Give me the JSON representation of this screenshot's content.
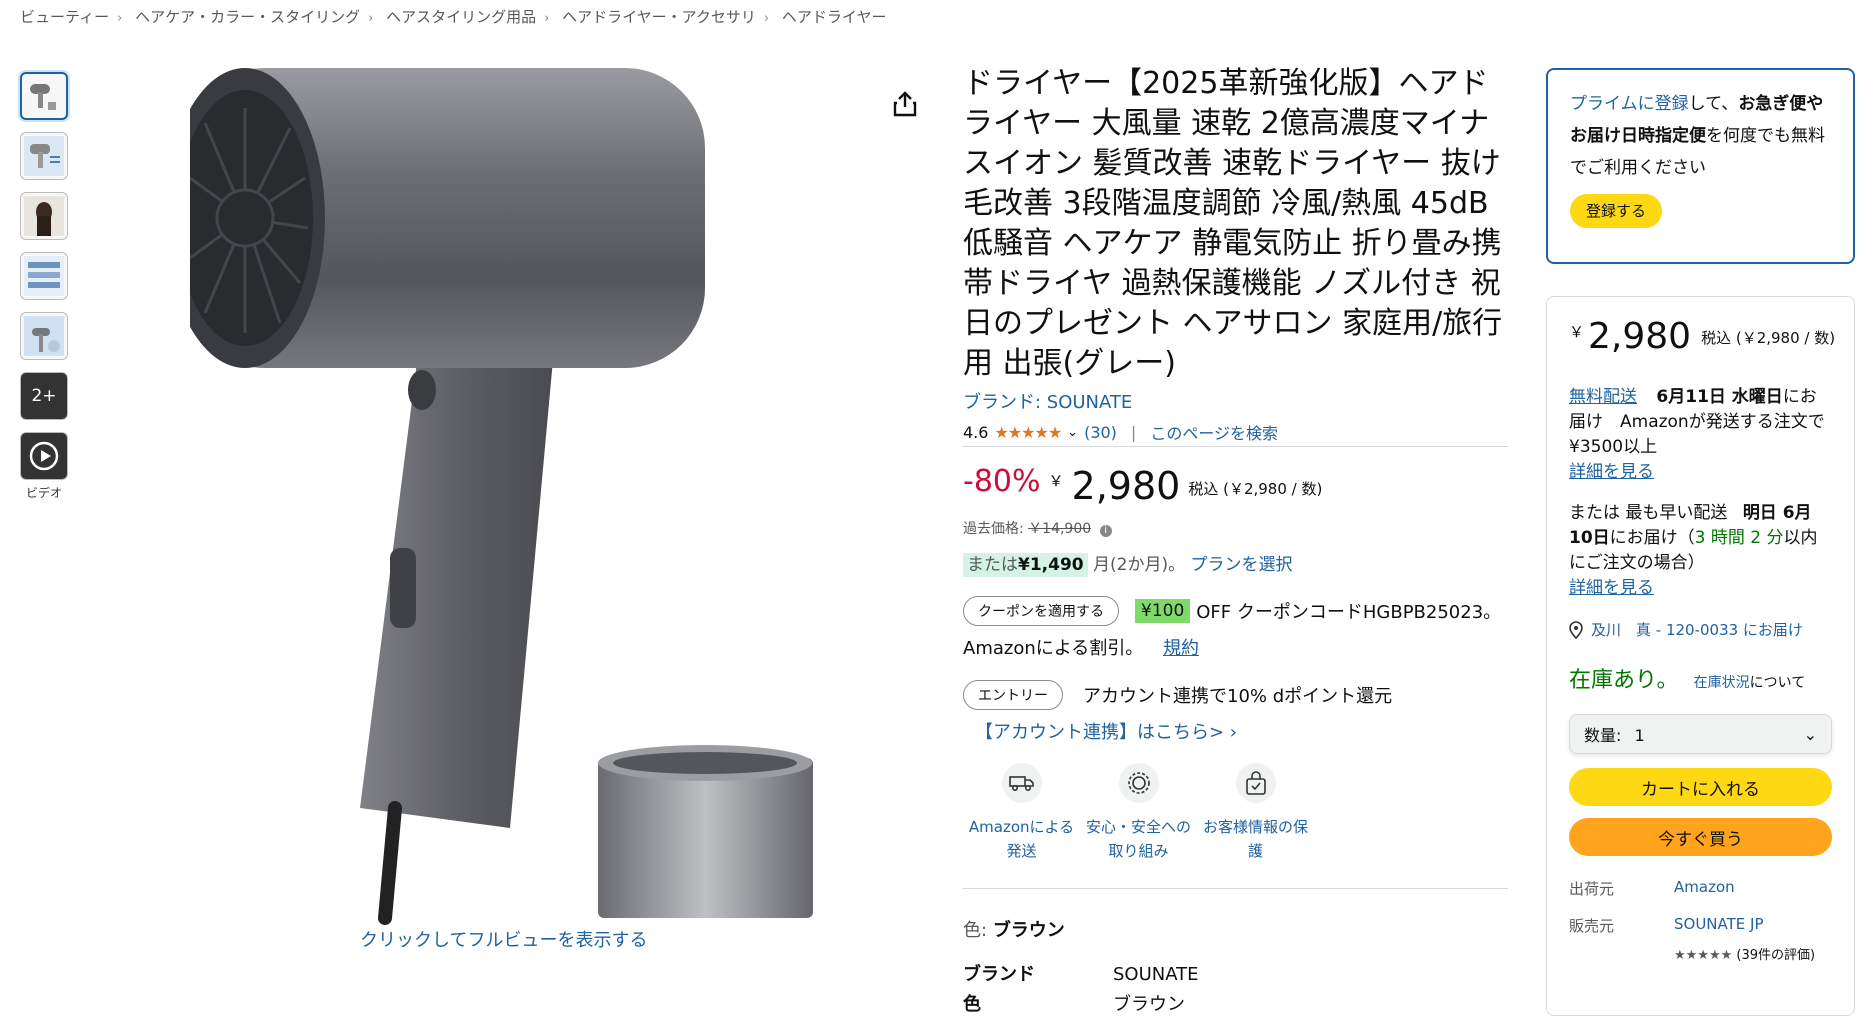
{
  "breadcrumb": [
    "ビューティー",
    "ヘアケア・カラー・スタイリング",
    "ヘアスタイリング用品",
    "ヘアドライヤー・アクセサリ",
    "ヘアドライヤー"
  ],
  "gallery": {
    "more_label": "2+",
    "video_label": "ビデオ",
    "fullview_label": "クリックしてフルビューを表示する"
  },
  "product": {
    "title": "ドライヤー【2025革新強化版】ヘアドライヤー 大風量 速乾 2億高濃度マイナスイオン 髪質改善 速乾ドライヤー 抜け毛改善 3段階温度調節 冷風/熱風 45dB 低騒音 ヘアケア 静電気防止 折り畳み携帯ドライヤ 過熱保護機能 ノズル付き 祝日のプレゼント ヘアサロン 家庭用/旅行用 出張(グレー)",
    "brand_link": "ブランド: SOUNATE",
    "rating": "4.6",
    "stars": "★★★★★",
    "review_count": "(30)",
    "search_page": "このページを検索"
  },
  "pricing": {
    "discount": "-80%",
    "yen": "￥",
    "price": "2,980",
    "tax_note": "税込 (￥2,980 / 数)",
    "past_label": "過去価格:",
    "past_price": "￥14,900",
    "installment_prefix": "または",
    "installment_amount": "¥1,490",
    "installment_suffix": "月(2か月)。",
    "installment_link": "プランを選択"
  },
  "coupon": {
    "button": "クーポンを適用する",
    "badge": "¥100",
    "text": "OFF クーポンコードHGBPB25023。",
    "amazon_discount": "Amazonによる割引。",
    "terms": "規約"
  },
  "entry": {
    "button": "エントリー",
    "text": "アカウント連携で10% dポイント還元",
    "link": "【アカウント連携】はこちら> ›"
  },
  "features": [
    {
      "icon": "truck-icon",
      "label": "Amazonによる発送"
    },
    {
      "icon": "shield-badge-icon",
      "label": "安心・安全への取り組み"
    },
    {
      "icon": "lock-bag-icon",
      "label": "お客様情報の保護"
    }
  ],
  "specs": {
    "color_label": "色:",
    "color_value": "ブラウン",
    "brand_key": "ブランド",
    "brand_value": "SOUNATE",
    "color_key": "色",
    "color_key_value": "ブラウン"
  },
  "prime_box": {
    "link": "プライムに登録",
    "text1": "して、",
    "bold": "お急ぎ便やお届け日時指定便",
    "text2": "を何度でも無料でご利用ください",
    "button": "登録する"
  },
  "buy_box": {
    "yen": "￥",
    "price": "2,980",
    "tax": "税込 (￥2,980 / 数)",
    "free_ship_link": "無料配送",
    "delivery_date": "6月11日 水曜日",
    "delivery_text": "にお届け　Amazonが発送する注文で¥3500以上",
    "details1": "詳細を見る",
    "fastest_prefix": "または 最も早い配送",
    "fastest_date": "明日 6月10日",
    "fastest_text1": "にお届け（",
    "fastest_time": "3 時間 2 分",
    "fastest_text2": "以内にご注文の場合）",
    "details2": "詳細を見る",
    "address": "及川　真 - 120-0033 にお届け",
    "in_stock": "在庫あり。",
    "stock_link": "在庫状況",
    "stock_suffix": "について",
    "qty_label": "数量:",
    "qty_value": "1",
    "cart_button": "カートに入れる",
    "buy_now_button": "今すぐ買う",
    "ships_from_key": "出荷元",
    "ships_from_value": "Amazon",
    "seller_key": "販売元",
    "seller_value": "SOUNATE JP",
    "seller_rating": "(39件の評価)"
  }
}
